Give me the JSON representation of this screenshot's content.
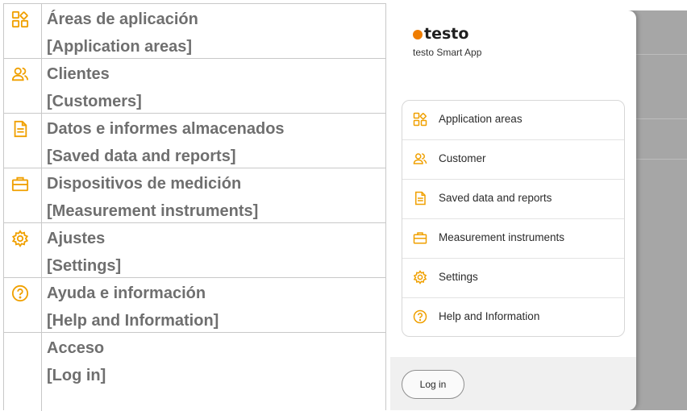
{
  "doc_rows": [
    {
      "spanish": "Áreas de aplicación",
      "english": "[Application areas]",
      "icon": "application-areas-icon"
    },
    {
      "spanish": "Clientes",
      "english": "[Customers]",
      "icon": "customer-icon"
    },
    {
      "spanish": "Datos e informes almacenados",
      "english": "[Saved data and reports]",
      "icon": "document-icon"
    },
    {
      "spanish": "Dispositivos de medición",
      "english": "[Measurement instruments]",
      "icon": "briefcase-icon"
    },
    {
      "spanish": "Ajustes",
      "english": "[Settings]",
      "icon": "gear-icon"
    },
    {
      "spanish": "Ayuda e información",
      "english": "[Help and Information]",
      "icon": "help-icon"
    },
    {
      "spanish": "Acceso",
      "english": "[Log in]",
      "icon": ""
    }
  ],
  "app": {
    "brand_name": "testo",
    "subtitle": "testo Smart App",
    "menu": [
      {
        "label": "Application areas",
        "icon": "application-areas-icon"
      },
      {
        "label": "Customer",
        "icon": "customer-icon"
      },
      {
        "label": "Saved data and reports",
        "icon": "document-icon"
      },
      {
        "label": "Measurement instruments",
        "icon": "briefcase-icon"
      },
      {
        "label": "Settings",
        "icon": "gear-icon"
      },
      {
        "label": "Help and Information",
        "icon": "help-icon"
      }
    ],
    "login_label": "Log in"
  },
  "colors": {
    "accent": "#f0a000",
    "brand_dot": "#ef7d00",
    "doc_text": "#6f6f6f"
  }
}
